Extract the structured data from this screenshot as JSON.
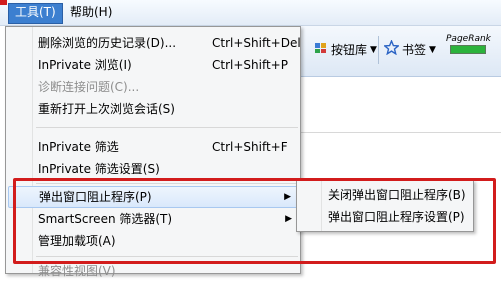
{
  "menubar": {
    "tools": "工具(T)",
    "help": "帮助(H)"
  },
  "commandbar": {
    "fav_label": "按钮库",
    "bookmark_label": "书签",
    "pagerank_label": "PageRank"
  },
  "menu": {
    "items": [
      {
        "label": "删除浏览的历史记录(D)...",
        "shortcut": "Ctrl+Shift+Del"
      },
      {
        "label": "InPrivate 浏览(I)",
        "shortcut": "Ctrl+Shift+P"
      },
      {
        "label": "诊断连接问题(C)..."
      },
      {
        "label": "重新打开上次浏览会话(S)"
      },
      {
        "label": "InPrivate 筛选",
        "shortcut": "Ctrl+Shift+F"
      },
      {
        "label": "InPrivate 筛选设置(S)"
      },
      {
        "label": "弹出窗口阻止程序(P)",
        "arrow": "▶"
      },
      {
        "label": "SmartScreen 筛选器(T)",
        "arrow": "▶"
      },
      {
        "label": "管理加载项(A)"
      },
      {
        "label": "兼容性视图(V)"
      }
    ]
  },
  "submenu": {
    "items": [
      {
        "label": "关闭弹出窗口阻止程序(B)"
      },
      {
        "label": "弹出窗口阻止程序设置(P)"
      }
    ]
  },
  "colors": {
    "annotation": "#d21c1c",
    "menu_active": "#3c7fd0",
    "disabled_text": "#8d8d8d"
  }
}
